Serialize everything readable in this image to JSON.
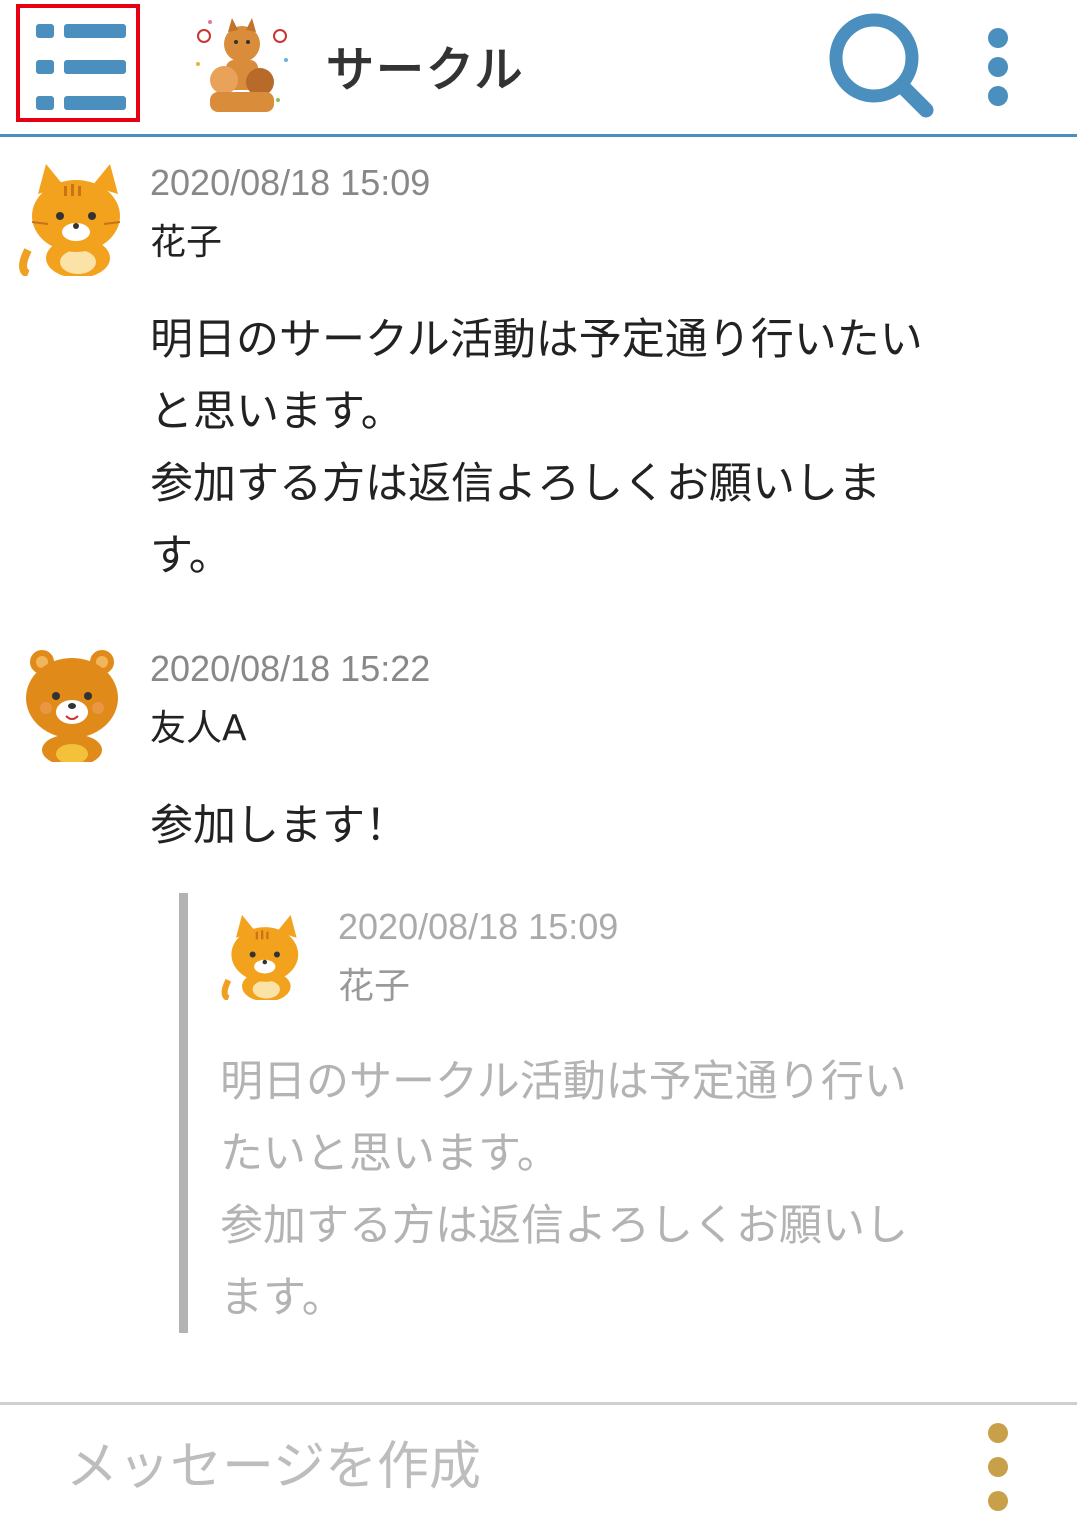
{
  "header": {
    "title": "サークル",
    "menu_icon": "menu-list-icon",
    "search_icon": "search-icon",
    "more_icon": "more-vertical-icon",
    "accent_color": "#4a8fbd",
    "highlight_color": "#e60012"
  },
  "messages": [
    {
      "timestamp": "2020/08/18 15:09",
      "author": "花子",
      "avatar": "cat-avatar",
      "text": "明日のサークル活動は予定通り行いたい\nと思います。\n参加する方は返信よろしくお願いしま\nす。"
    },
    {
      "timestamp": "2020/08/18 15:22",
      "author": "友人A",
      "avatar": "bear-avatar",
      "text": "参加します！",
      "quote": {
        "timestamp": "2020/08/18 15:09",
        "author": "花子",
        "avatar": "cat-avatar",
        "text": "明日のサークル活動は予定通り行い\nたいと思います。\n参加する方は返信よろしくお願いし\nます。"
      }
    }
  ],
  "composer": {
    "placeholder": "メッセージを作成",
    "more_icon": "more-vertical-icon",
    "more_color": "#c9a04a"
  }
}
